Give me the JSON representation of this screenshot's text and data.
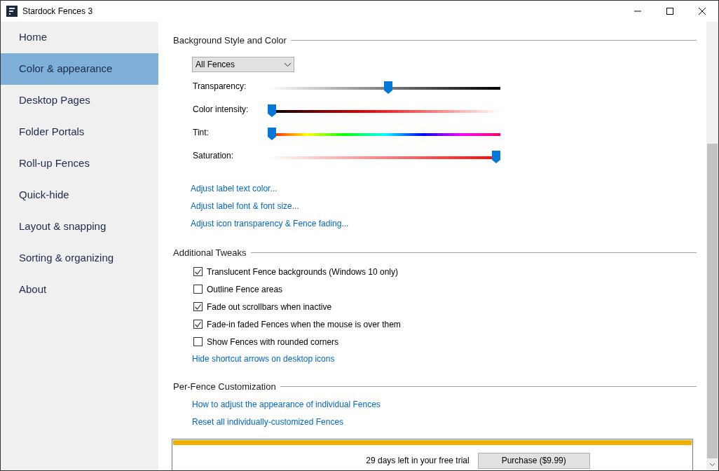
{
  "window": {
    "title": "Stardock Fences 3"
  },
  "sidebar": {
    "items": [
      {
        "label": "Home",
        "selected": false
      },
      {
        "label": "Color & appearance",
        "selected": true
      },
      {
        "label": "Desktop Pages",
        "selected": false
      },
      {
        "label": "Folder Portals",
        "selected": false
      },
      {
        "label": "Roll-up Fences",
        "selected": false
      },
      {
        "label": "Quick-hide",
        "selected": false
      },
      {
        "label": "Layout & snapping",
        "selected": false
      },
      {
        "label": "Sorting & organizing",
        "selected": false
      },
      {
        "label": "About",
        "selected": false
      }
    ]
  },
  "background_section": {
    "title": "Background Style and Color",
    "dropdown": {
      "value": "All Fences"
    },
    "sliders": [
      {
        "kind": "transparency",
        "label": "Transparency:",
        "level": 0.52
      },
      {
        "kind": "intensity",
        "label": "Color intensity:",
        "level": 0
      },
      {
        "kind": "tint",
        "label": "Tint:",
        "level": 0
      },
      {
        "kind": "saturation",
        "label": "Saturation:",
        "level": 1
      }
    ],
    "links": [
      "Adjust label text color...",
      "Adjust label font & font size...",
      "Adjust icon transparency & Fence fading..."
    ]
  },
  "tweaks_section": {
    "title": "Additional Tweaks",
    "checkboxes": [
      {
        "label": "Translucent Fence backgrounds (Windows 10 only)",
        "checked": true
      },
      {
        "label": "Outline Fence areas",
        "checked": false
      },
      {
        "label": "Fade out scrollbars when inactive",
        "checked": true
      },
      {
        "label": "Fade-in faded Fences when the mouse is over them",
        "checked": true
      },
      {
        "label": "Show Fences with rounded corners",
        "checked": false
      }
    ],
    "links": [
      "Hide shortcut arrows on desktop icons"
    ]
  },
  "per_fence_section": {
    "title": "Per-Fence Customization",
    "links": [
      "How to adjust the appearance of individual Fences",
      "Reset all individually-customized Fences"
    ]
  },
  "trial_bar": {
    "message": "29 days left in your free trial",
    "button": "Purchase ($9.99)"
  }
}
